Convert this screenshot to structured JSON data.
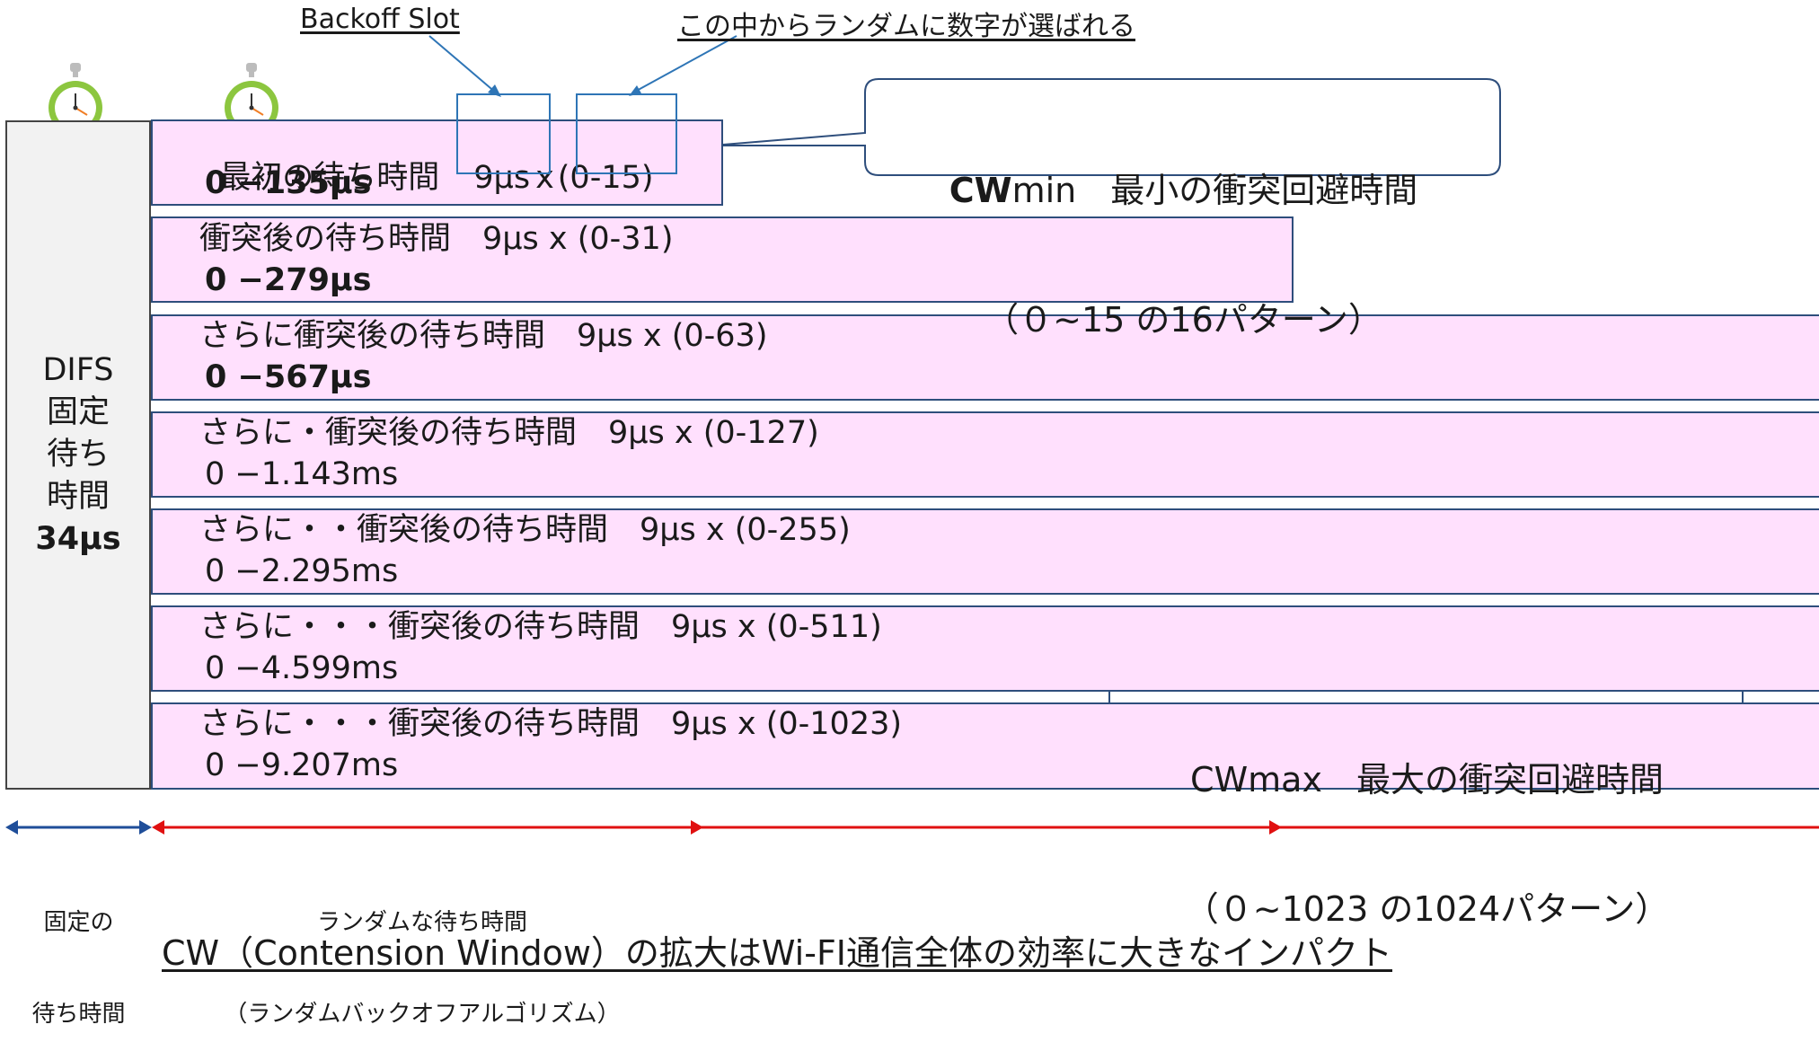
{
  "difs": {
    "line1": "DIFS",
    "line2": "固定",
    "line3": "待ち",
    "line4": "時間",
    "value": "34μs"
  },
  "slot_labels": {
    "backoff": "Backoff Slot",
    "random": "この中からランダムに数字が選ばれる"
  },
  "rows": [
    {
      "label_main": "最初の待ち時間",
      "label_slot": "9μs",
      "label_x": "x",
      "label_range": "(0-15)",
      "value": "0 −135μs",
      "bold": true
    },
    {
      "label": "衝突後の待ち時間　9μs x (0-31)",
      "value": "0 −279μs",
      "bold": true
    },
    {
      "label": "さらに衝突後の待ち時間　9μs x (0-63)",
      "value": "0 −567μs",
      "bold": true
    },
    {
      "label": "さらに・衝突後の待ち時間　9μs x (0-127)",
      "value": "0 −1.143ms",
      "bold": false
    },
    {
      "label": "さらに・・衝突後の待ち時間　9μs x (0-255)",
      "value": "0 −2.295ms",
      "bold": false
    },
    {
      "label": "さらに・・・衝突後の待ち時間　9μs x (0-511)",
      "value": "0 −4.599ms",
      "bold": false
    },
    {
      "label": "さらに・・・衝突後の待ち時間　9μs x (0-1023)",
      "value": "0 −9.207ms",
      "bold": false
    }
  ],
  "cwmin": {
    "title_bold": "CW",
    "title_rest": "min　最小の衝突回避時間",
    "subtitle": "（０~15 の16パターン）"
  },
  "cwmax": {
    "title": "CWmax　最大の衝突回避時間",
    "subtitle": "（０~1023 の1024パターン）"
  },
  "fixed_label": {
    "line1": "固定の",
    "line2": "待ち時間"
  },
  "random_label": {
    "line1": "ランダムな待ち時間",
    "line2": "（ランダムバックオフアルゴリズム）"
  },
  "bottom_caption": "CW（Contension Window）の拡大はWi-FI通信全体の効率に大きなインパクト",
  "colors": {
    "bar_fill": "#ffe0fd",
    "bar_border": "#2e4e7c",
    "difs_fill": "#f2f2f2",
    "slot_box": "#2e75b6",
    "fixed_arrow": "#1f4e99",
    "random_arrow": "#e01010",
    "stopwatch": "#8cc63f"
  }
}
